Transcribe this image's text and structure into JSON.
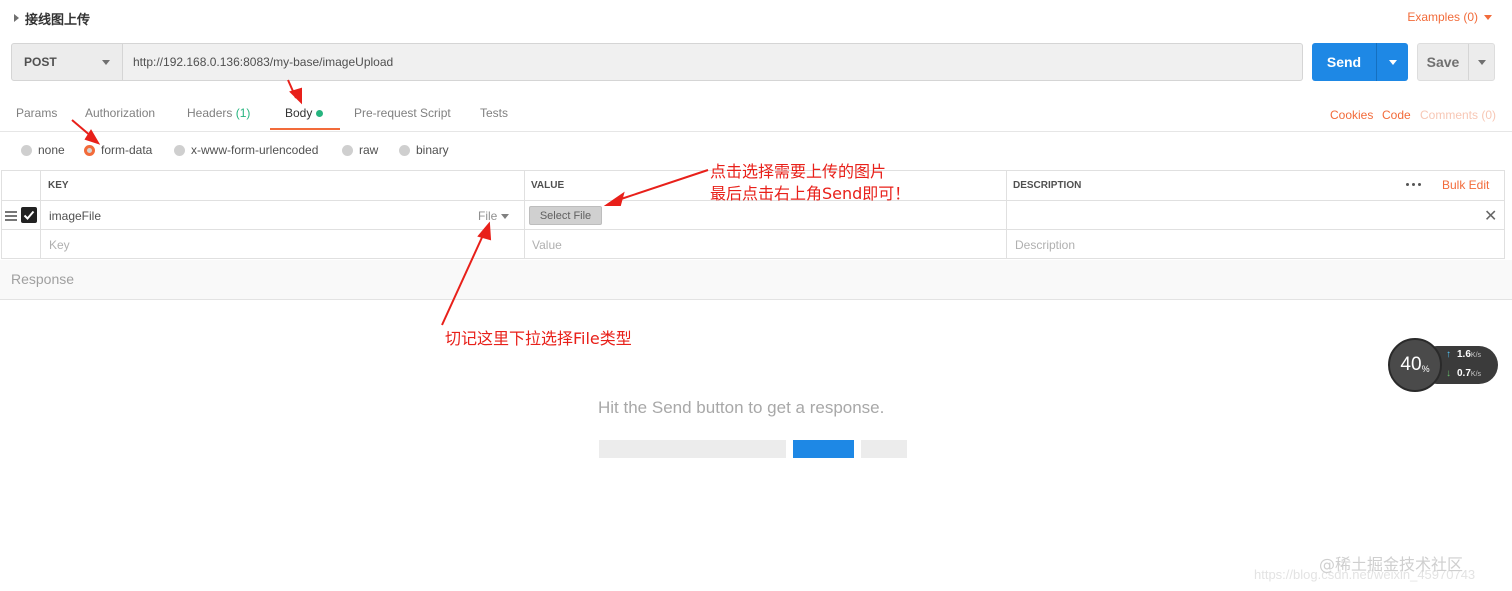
{
  "request": {
    "title": "接线图上传",
    "examples_label": "Examples (0)"
  },
  "url_bar": {
    "method": "POST",
    "url": "http://192.168.0.136:8083/my-base/imageUpload",
    "send_label": "Send",
    "save_label": "Save"
  },
  "tabs": {
    "params": "Params",
    "authorization": "Authorization",
    "headers": "Headers",
    "headers_count": "(1)",
    "body": "Body",
    "prerequest": "Pre-request Script",
    "tests": "Tests"
  },
  "right_links": {
    "cookies": "Cookies",
    "code": "Code",
    "comments": "Comments (0)"
  },
  "body_modes": {
    "selected": "form-data",
    "options": [
      "none",
      "form-data",
      "x-www-form-urlencoded",
      "raw",
      "binary"
    ]
  },
  "table": {
    "headers": {
      "key": "KEY",
      "value": "VALUE",
      "description": "DESCRIPTION"
    },
    "bulk_edit": "Bulk Edit",
    "row": {
      "key": "imageFile",
      "type": "File",
      "select_file": "Select File"
    },
    "placeholders": {
      "key": "Key",
      "value": "Value",
      "description": "Description"
    }
  },
  "response": {
    "label": "Response",
    "hint": "Hit the Send button to get a response."
  },
  "annotations": {
    "value_note_line1": "点击选择需要上传的图片",
    "value_note_line2": "最后点击右上角Send即可！",
    "type_note": "切记这里下拉选择File类型"
  },
  "network_widget": {
    "percent": "40",
    "percent_unit": "%",
    "up_speed": "1.6",
    "down_speed": "0.7",
    "unit": "K/s"
  },
  "watermark": {
    "brand": "@稀土掘金技术社区",
    "url": "https://blog.csdn.net/weixin_45970743"
  },
  "colors": {
    "accent": "#f26b3a",
    "primary": "#1e88e5",
    "success": "#26b47f",
    "annotation": "#e8201a"
  }
}
